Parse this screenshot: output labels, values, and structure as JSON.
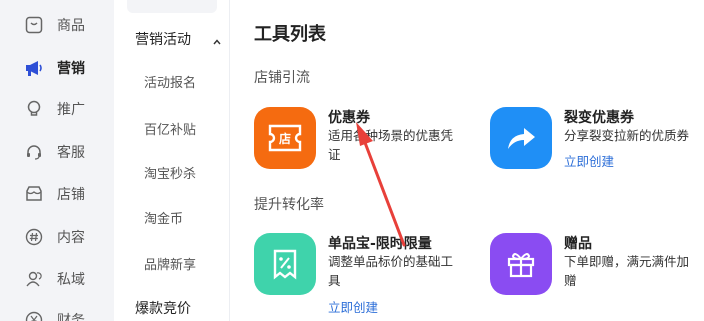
{
  "nav": {
    "items": [
      {
        "label": "商品",
        "icon": "box-icon"
      },
      {
        "label": "营销",
        "icon": "megaphone-icon",
        "active": true
      },
      {
        "label": "推广",
        "icon": "lightbulb-icon"
      },
      {
        "label": "客服",
        "icon": "headset-icon"
      },
      {
        "label": "店铺",
        "icon": "shop-icon"
      },
      {
        "label": "内容",
        "icon": "hashtag-icon"
      },
      {
        "label": "私域",
        "icon": "users-icon"
      },
      {
        "label": "财务",
        "icon": "yen-icon"
      }
    ]
  },
  "submenu": {
    "heading": "营销活动",
    "items": [
      "活动报名",
      "百亿补贴",
      "淘宝秒杀",
      "淘金币",
      "品牌新享"
    ],
    "bottom": "爆款竞价"
  },
  "main": {
    "title": "工具列表",
    "sections": [
      {
        "label": "店铺引流",
        "cards": [
          {
            "name": "优惠券",
            "desc": "适用各种场景的优惠凭证",
            "link": "",
            "icon": "shop-coupon-icon",
            "icon_text": "店",
            "color": "#f56b10"
          },
          {
            "name": "裂变优惠券",
            "desc": "分享裂变拉新的优质券",
            "link": "立即创建",
            "icon": "share-arrow-icon",
            "color": "#1f8ff6"
          }
        ]
      },
      {
        "label": "提升转化率",
        "cards": [
          {
            "name": "单品宝-限时限量",
            "desc": "调整单品标价的基础工具",
            "link": "立即创建",
            "icon": "percent-tag-icon",
            "color": "#3fd3ab"
          },
          {
            "name": "赠品",
            "desc": "下单即赠，满元满件加赠",
            "link": "",
            "icon": "gift-icon",
            "color": "#8a4cf2"
          }
        ]
      }
    ]
  },
  "colors": {
    "accent": "#2e6fd8",
    "annotation_arrow": "#e8403a"
  }
}
